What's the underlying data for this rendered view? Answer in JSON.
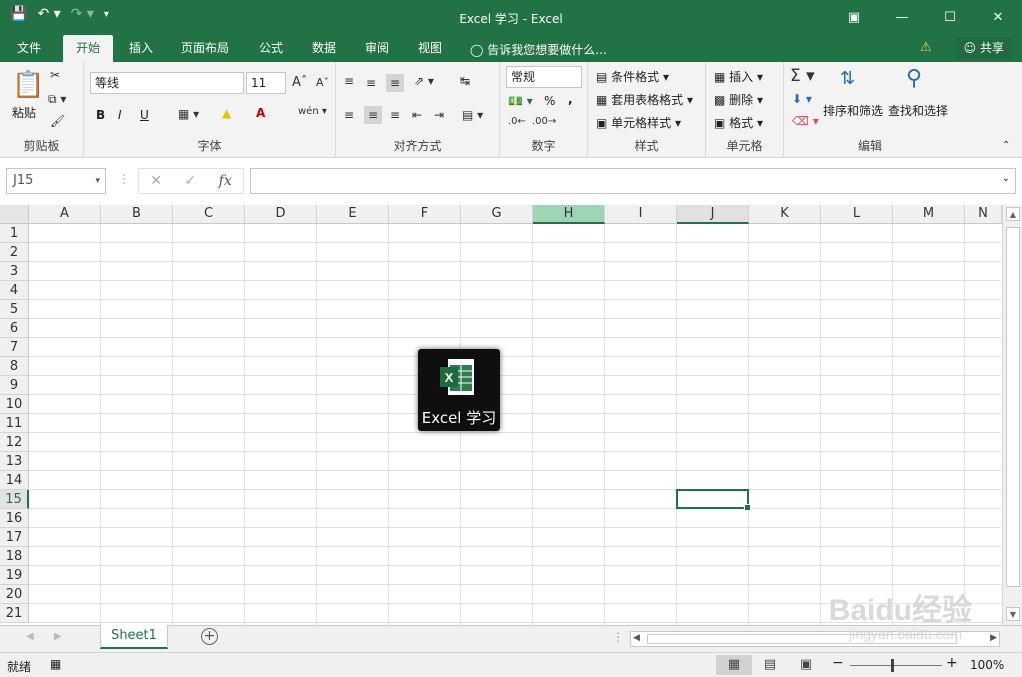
{
  "window": {
    "title": "Excel 学习 - Excel"
  },
  "tabs": [
    "文件",
    "开始",
    "插入",
    "页面布局",
    "公式",
    "数据",
    "审阅",
    "视图"
  ],
  "active_tab": "开始",
  "tell_me": "告诉我您想要做什么...",
  "share": "共享",
  "ribbon": {
    "clipboard": {
      "paste": "粘贴",
      "label": "剪贴板"
    },
    "font": {
      "name": "等线",
      "size": "11",
      "bold": "B",
      "italic": "I",
      "underline": "U",
      "label": "字体"
    },
    "align": {
      "label": "对齐方式"
    },
    "number": {
      "format": "常规",
      "percent": "%",
      "comma": ",",
      "label": "数字"
    },
    "styles": {
      "conditional": "条件格式",
      "table": "套用表格格式",
      "cell": "单元格样式",
      "label": "样式"
    },
    "cells": {
      "insert": "插入",
      "delete": "删除",
      "format": "格式",
      "label": "单元格"
    },
    "editing": {
      "sort": "排序和筛选",
      "find": "查找和选择",
      "label": "编辑"
    }
  },
  "formula_bar": {
    "name_box": "J15",
    "fx": "fx",
    "value": ""
  },
  "columns": [
    "A",
    "B",
    "C",
    "D",
    "E",
    "F",
    "G",
    "H",
    "I",
    "J",
    "K",
    "L",
    "M",
    "N"
  ],
  "rows": [
    "1",
    "2",
    "3",
    "4",
    "5",
    "6",
    "7",
    "8",
    "9",
    "10",
    "11",
    "12",
    "13",
    "14",
    "15",
    "16",
    "17",
    "18",
    "19",
    "20",
    "21"
  ],
  "selected_column": "H",
  "active_cell": "J15",
  "desktop_icon": {
    "label": "Excel 学习",
    "letter": "X"
  },
  "sheets": [
    "Sheet1"
  ],
  "status": {
    "ready": "就绪",
    "zoom": "100%"
  },
  "watermark": {
    "brand": "Baidu经验",
    "url": "jingyan.baidu.com"
  },
  "colors": {
    "accent": "#217346",
    "selected_header": "#9fd5b7"
  }
}
